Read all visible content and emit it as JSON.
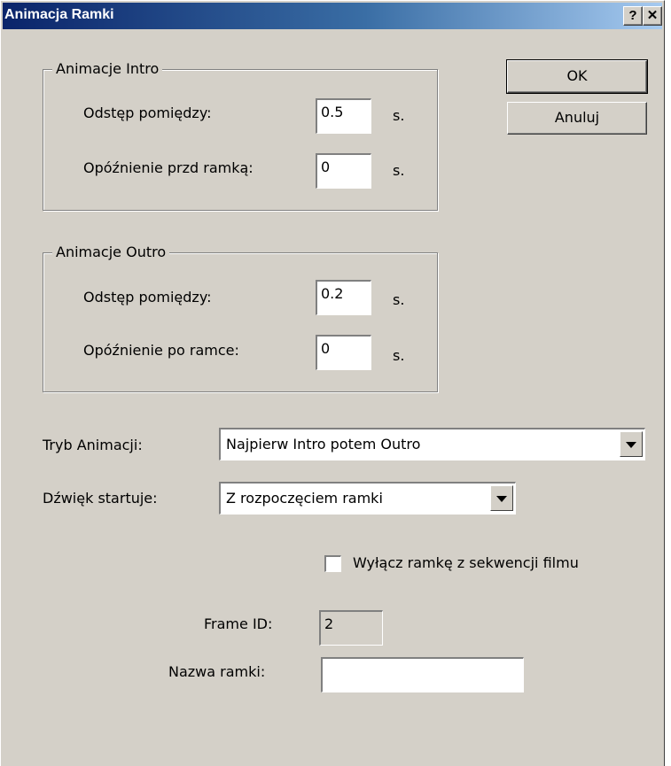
{
  "window": {
    "title": "Animacja Ramki",
    "help_label": "?",
    "close_label": "✕"
  },
  "buttons": {
    "ok_label": "OK",
    "cancel_label": "Anuluj"
  },
  "intro": {
    "legend": "Animacje Intro",
    "spacing_label": "Odstęp pomiędzy:",
    "spacing_value": "0.5",
    "spacing_unit": "s.",
    "delay_label": "Opóźnienie przd ramką:",
    "delay_value": "0",
    "delay_unit": "s."
  },
  "outro": {
    "legend": "Animacje Outro",
    "spacing_label": "Odstęp pomiędzy:",
    "spacing_value": "0.2",
    "spacing_unit": "s.",
    "delay_label": "Opóźnienie po ramce:",
    "delay_value": "0",
    "delay_unit": "s."
  },
  "mode": {
    "label": "Tryb Animacji:",
    "selected": "Najpierw Intro potem Outro"
  },
  "sound": {
    "label": "Dźwięk startuje:",
    "selected": "Z rozpoczęciem ramki"
  },
  "exclude": {
    "label": "Wyłącz ramkę z sekwencji filmu",
    "checked": false
  },
  "frame": {
    "id_label": "Frame ID:",
    "id_value": "2",
    "name_label": "Nazwa ramki:",
    "name_value": ""
  },
  "colors": {
    "face": "#d4d0c8",
    "title_start": "#0a246a",
    "title_end": "#a6caf0"
  }
}
